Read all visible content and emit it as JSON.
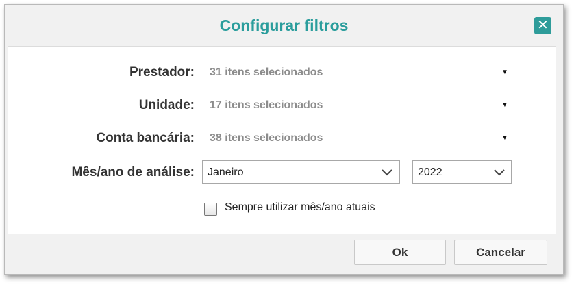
{
  "dialog": {
    "title": "Configurar filtros",
    "close_icon": "close-icon"
  },
  "filters": {
    "prestador": {
      "label": "Prestador:",
      "value": "31 itens selecionados"
    },
    "unidade": {
      "label": "Unidade:",
      "value": "17 itens selecionados"
    },
    "conta_bancaria": {
      "label": "Conta bancária:",
      "value": "38 itens selecionados"
    },
    "mes_ano": {
      "label": "Mês/ano de análise:",
      "month": "Janeiro",
      "year": "2022"
    },
    "always_current": {
      "label": "Sempre utilizar mês/ano atuais",
      "checked": false
    }
  },
  "buttons": {
    "ok": "Ok",
    "cancel": "Cancelar"
  },
  "colors": {
    "accent": "#2a9d9c",
    "dialog_bg": "#f1f1f1",
    "panel_bg": "#ffffff"
  }
}
